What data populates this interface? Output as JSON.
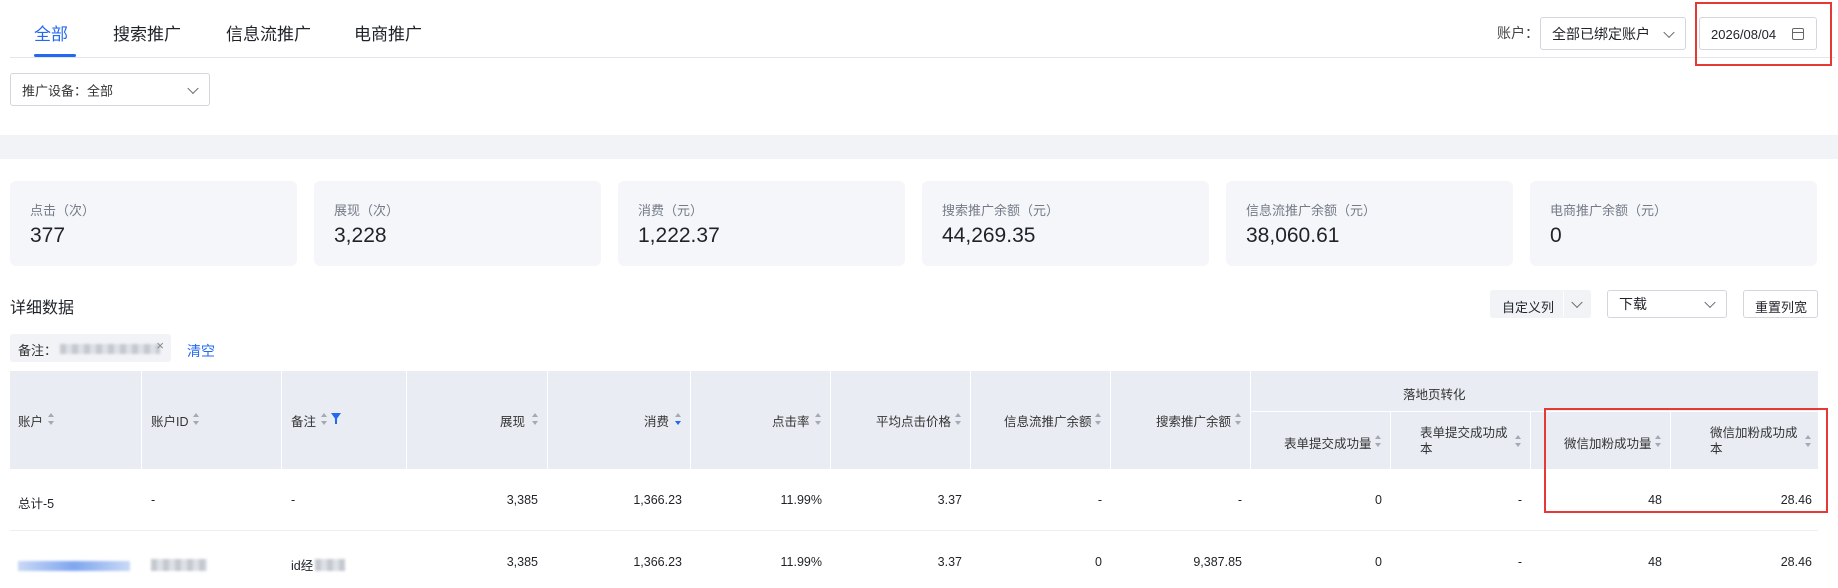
{
  "tabs": [
    {
      "label": "全部",
      "active": true
    },
    {
      "label": "搜索推广"
    },
    {
      "label": "信息流推广"
    },
    {
      "label": "电商推广"
    }
  ],
  "account": {
    "label": "账户：",
    "value": "全部已绑定账户"
  },
  "date": {
    "value": "2026/08/04"
  },
  "device": {
    "value": "推广设备：全部"
  },
  "stats": [
    {
      "label": "点击（次）",
      "value": "377"
    },
    {
      "label": "展现（次）",
      "value": "3,228"
    },
    {
      "label": "消费（元）",
      "value": "1,222.37"
    },
    {
      "label": "搜索推广余额（元）",
      "value": "44,269.35"
    },
    {
      "label": "信息流推广余额（元）",
      "value": "38,060.61"
    },
    {
      "label": "电商推广余额（元）",
      "value": "0"
    }
  ],
  "detail": {
    "title": "详细数据",
    "custom_columns": "自定义列",
    "download": "下载",
    "reset_width": "重置列宽",
    "filter_label": "备注：",
    "clear": "清空"
  },
  "table": {
    "group_header": "落地页转化",
    "headers": {
      "account": "账户",
      "account_id": "账户ID",
      "note": "备注",
      "impressions": "展现",
      "cost": "消费",
      "ctr": "点击率",
      "avg_cpc": "平均点击价格",
      "feed_balance": "信息流推广余额",
      "search_balance": "搜索推广余额",
      "form_count": "表单提交成功量",
      "form_cost": "表单提交成功成本",
      "wechat_count": "微信加粉成功量",
      "wechat_cost": "微信加粉成功成本"
    },
    "rows": [
      {
        "account": "总计-5",
        "account_id": "-",
        "note": "-",
        "impressions": "3,385",
        "cost": "1,366.23",
        "ctr": "11.99%",
        "avg_cpc": "3.37",
        "feed_balance": "-",
        "search_balance": "-",
        "form_count": "0",
        "form_cost": "-",
        "wechat_count": "48",
        "wechat_cost": "28.46"
      },
      {
        "account": "",
        "account_id": "",
        "note": "id经",
        "impressions": "3,385",
        "cost": "1,366.23",
        "ctr": "11.99%",
        "avg_cpc": "3.37",
        "feed_balance": "0",
        "search_balance": "9,387.85",
        "form_count": "0",
        "form_cost": "-",
        "wechat_count": "48",
        "wechat_cost": "28.46"
      }
    ]
  },
  "colors": {
    "accent": "#2468f2",
    "highlight": "#e53935",
    "header_bg": "#e9ecf3"
  }
}
